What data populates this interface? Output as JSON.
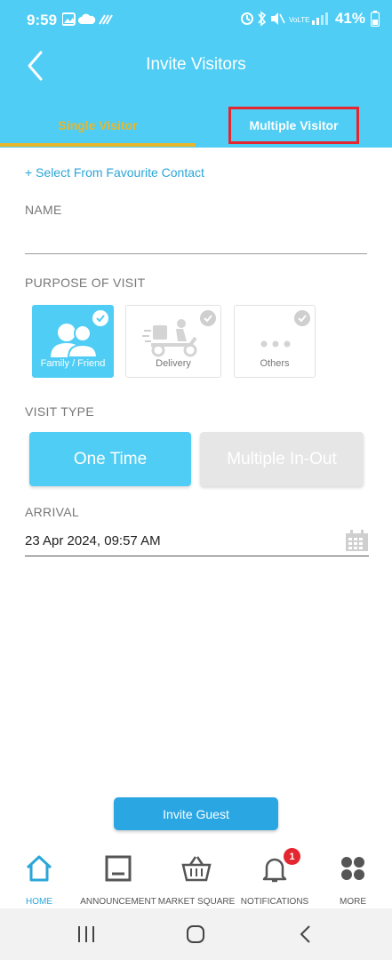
{
  "status_bar": {
    "time": "9:59",
    "battery": "41%"
  },
  "header": {
    "title": "Invite Visitors"
  },
  "tabs": [
    {
      "label": "Single Visitor",
      "active": true
    },
    {
      "label": "Multiple Visitor",
      "active": false,
      "highlighted": true
    }
  ],
  "form": {
    "favourite_link": "+ Select From Favourite Contact",
    "name_label": "NAME",
    "name_value": "",
    "purpose_label": "PURPOSE OF VISIT",
    "purposes": [
      {
        "label": "Family / Friend",
        "icon": "family-icon",
        "selected": true
      },
      {
        "label": "Delivery",
        "icon": "delivery-scooter-icon",
        "selected": false
      },
      {
        "label": "Others",
        "icon": "more-dots-icon",
        "selected": false
      }
    ],
    "visit_type_label": "VISIT TYPE",
    "visit_types": [
      {
        "label": "One Time",
        "selected": true
      },
      {
        "label": "Multiple In-Out",
        "selected": false
      }
    ],
    "arrival_label": "ARRIVAL",
    "arrival_value": "23 Apr 2024, 09:57 AM"
  },
  "invite_button": "Invite Guest",
  "bottom_nav": [
    {
      "label": "HOME",
      "icon": "home-icon",
      "active": true
    },
    {
      "label": "ANNOUNCEMENT",
      "icon": "announcement-icon"
    },
    {
      "label": "MARKET SQUARE",
      "icon": "basket-icon"
    },
    {
      "label": "NOTIFICATIONS",
      "icon": "bell-icon",
      "badge": "1"
    },
    {
      "label": "MORE",
      "icon": "grid-icon"
    }
  ],
  "colors": {
    "primary": "#4fcdf4",
    "accent": "#e8b72c",
    "link": "#2aa6d8",
    "highlight_border": "#e3262f"
  }
}
